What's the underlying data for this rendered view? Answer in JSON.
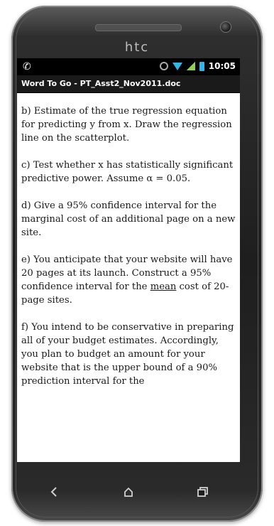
{
  "device": {
    "brand": "htc"
  },
  "status_bar": {
    "time": "10:05",
    "wifi_color": "#33b5e5",
    "battery_color": "#33b5e5",
    "signal_color": "#8fd14f"
  },
  "app": {
    "title": "Word To Go - PT_Asst2_Nov2011.doc"
  },
  "document": {
    "paragraphs": [
      {
        "pre": "b) Estimate of the true regression equation for predicting y from x. Draw the regression line on the scatterplot.",
        "underlined": "",
        "post": ""
      },
      {
        "pre": "c) Test whether x has statistically significant predictive power. Assume α = 0.05.",
        "underlined": "",
        "post": ""
      },
      {
        "pre": "d) Give a 95% confidence interval for the marginal cost of an additional page on a new site.",
        "underlined": "",
        "post": ""
      },
      {
        "pre": "e) You anticipate that your website will have 20 pages at its launch. Construct a 95% confidence interval for the ",
        "underlined": "mean",
        "post": " cost of 20-page sites."
      },
      {
        "pre": "f) You intend to be conservative in preparing all of your budget estimates. Accordingly, you plan to budget an amount for your website that is the upper bound of a 90% prediction interval for the",
        "underlined": "",
        "post": ""
      }
    ]
  },
  "nav": {
    "back_icon": "back-icon",
    "home_icon": "home-icon",
    "recents_icon": "recents-icon"
  }
}
